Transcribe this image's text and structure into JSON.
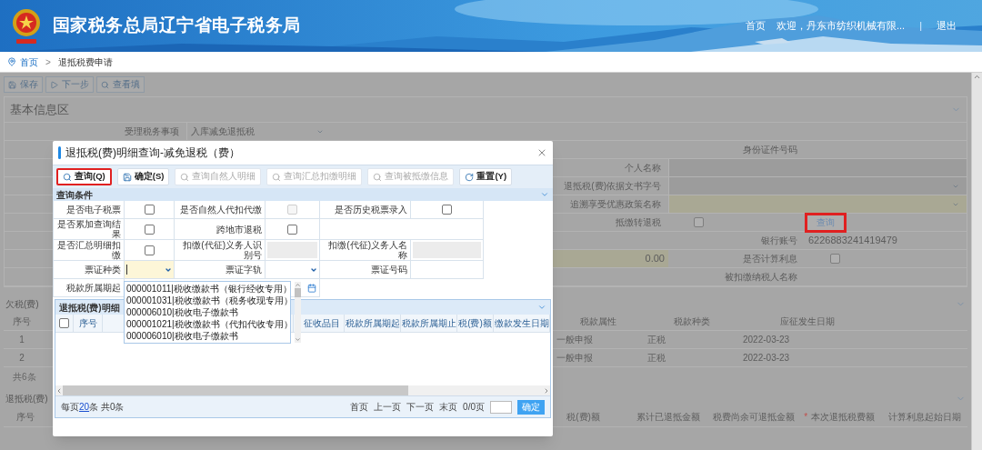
{
  "header": {
    "title": "国家税务总局辽宁省电子税务局",
    "nav": [
      {
        "kind": "link",
        "text": "首页"
      },
      {
        "kind": "link",
        "text": "欢迎，丹东市纺织机械有限..."
      },
      {
        "kind": "separator",
        "text": "|"
      },
      {
        "kind": "link",
        "text": "退出"
      }
    ]
  },
  "breadcrumb": {
    "items": [
      "首页",
      "退抵税费申请"
    ],
    "separator": ">"
  },
  "toolbar": [
    {
      "kind": "save",
      "label": "保存"
    },
    {
      "kind": "next",
      "label": "下一步"
    },
    {
      "kind": "view",
      "label": "查看填"
    }
  ],
  "basic_info": {
    "title": "基本信息区",
    "business_item": {
      "label": "受理税务事项",
      "value": "入库减免退抵税"
    },
    "id_number": {
      "label": "身份证件号码"
    },
    "person_name": {
      "label": "个人名称"
    },
    "document_number": {
      "label": "退抵税(费)依据文书字号"
    },
    "policy_name": {
      "label": "追溯享受优惠政策名称"
    },
    "offset_to_refund": {
      "label": "抵缴转退税",
      "checked": false
    },
    "query_button": {
      "label": "查询",
      "highlighted": true
    },
    "bank_account": {
      "label": "银行账号",
      "value": "6226883241419479"
    },
    "amount": "0.00",
    "interest": {
      "label": "是否计算利息",
      "checked": false
    },
    "withheld_name": {
      "label": "被扣缴纳税人名称"
    }
  },
  "arrears": {
    "title": "欠税(费)",
    "columns": [
      "序号",
      "税款属性",
      "税款种类",
      "应征发生日期"
    ],
    "rows": [
      {
        "no": "1",
        "declaration": "一般申报",
        "tax_type": "正税",
        "date": "2022-03-23"
      },
      {
        "no": "2",
        "declaration": "一般申报",
        "tax_type": "正税",
        "date": "2022-03-23"
      }
    ],
    "total": "共6条"
  },
  "refund": {
    "title": "退抵税(费)",
    "columns": [
      {
        "label": "序号",
        "required": false
      },
      {
        "label": "税(费)额",
        "required": false
      },
      {
        "label": "累计已退抵金额",
        "required": false
      },
      {
        "label": "税费尚余可退抵金额",
        "required": false
      },
      {
        "label": "本次退抵税费额",
        "required": true,
        "required_mark": "*"
      },
      {
        "label": "计算利息起始日期",
        "required": false
      }
    ]
  },
  "dialog": {
    "title": "退抵税(费)明细查询-减免退税（费）",
    "toolbar": [
      {
        "kind": "search",
        "label": "查询(Q)",
        "disabled": false,
        "highlighted": true
      },
      {
        "kind": "save",
        "label": "确定(S)",
        "disabled": false,
        "highlighted": false
      },
      {
        "kind": "search",
        "label": "查询自然人明细",
        "disabled": true,
        "highlighted": false
      },
      {
        "kind": "search",
        "label": "查询汇总扣缴明细",
        "disabled": true,
        "highlighted": false
      },
      {
        "kind": "search",
        "label": "查询被抵缴信息",
        "disabled": true,
        "highlighted": false
      },
      {
        "kind": "reset",
        "label": "重置(Y)",
        "disabled": false,
        "highlighted": false
      }
    ],
    "conditions": {
      "title": "查询条件",
      "fields": [
        {
          "kind": "checkbox",
          "label": "是否电子税票",
          "checked": false,
          "disabled": false
        },
        {
          "kind": "checkbox",
          "label": "是否自然人代扣代缴",
          "checked": false,
          "disabled": true
        },
        {
          "kind": "checkbox",
          "label": "是否历史税票录入",
          "checked": false,
          "disabled": false
        },
        {
          "kind": "checkbox",
          "label": "是否累加查询结果",
          "checked": false,
          "disabled": false
        },
        {
          "kind": "checkbox",
          "label": "跨地市退税",
          "checked": false,
          "disabled": false
        },
        {
          "kind": "blank"
        },
        {
          "kind": "checkbox",
          "label": "是否汇总明细扣缴",
          "checked": false,
          "disabled": false
        },
        {
          "kind": "readonly",
          "label": "扣缴(代征)义务人识别号"
        },
        {
          "kind": "readonly",
          "label": "扣缴(代征)义务人名称"
        },
        {
          "kind": "combo",
          "label": "票证种类"
        },
        {
          "kind": "select",
          "label": "票证字轨"
        },
        {
          "kind": "text",
          "label": "票证号码"
        },
        {
          "kind": "date",
          "label": "税款所属期起"
        }
      ]
    },
    "dropdown": {
      "options": [
        "000001011|税收缴款书（银行经收专用）",
        "000001031|税收缴款书（税务收现专用）",
        "000006010|税收电子缴款书",
        "000001021|税收缴款书（代扣代收专用）",
        "000006010|税收电子缴款书"
      ]
    },
    "detail": {
      "title": "退抵税(费)明细",
      "select_all": false,
      "columns": [
        "序号",
        "征收品目",
        "税款所属期起",
        "税款所属期止",
        "税(费)额",
        "缴款发生日期"
      ]
    },
    "pager": {
      "prefix": "每页",
      "page_size": "20",
      "suffix": "条 共0条",
      "links": [
        "首页",
        "上一页",
        "下一页",
        "末页"
      ],
      "page_info": "0/0页",
      "go": "确定"
    }
  }
}
